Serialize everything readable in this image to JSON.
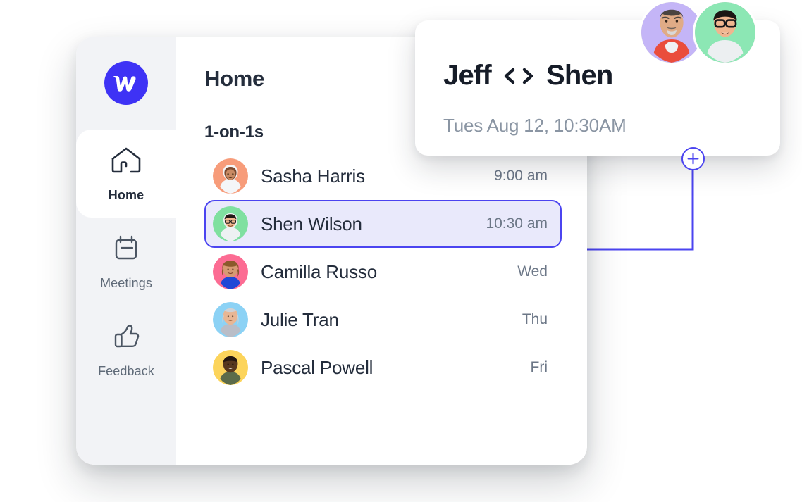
{
  "app": {
    "logo_icon": "webflow-logo-icon",
    "brand_color": "#3E32F5"
  },
  "sidebar": {
    "items": [
      {
        "label": "Home",
        "icon": "home-icon",
        "active": true
      },
      {
        "label": "Meetings",
        "icon": "calendar-icon",
        "active": false
      },
      {
        "label": "Feedback",
        "icon": "thumbs-up-icon",
        "active": false
      }
    ]
  },
  "main": {
    "page_title": "Home",
    "section_title": "1-on-1s",
    "rows": [
      {
        "name": "Sasha Harris",
        "time": "9:00 am",
        "avatar_bg": "#F79C7A",
        "selected": false
      },
      {
        "name": "Shen Wilson",
        "time": "10:30 am",
        "avatar_bg": "#7FE0A0",
        "selected": true
      },
      {
        "name": "Camilla Russo",
        "time": "Wed",
        "avatar_bg": "#FC6C93",
        "selected": false
      },
      {
        "name": "Julie Tran",
        "time": "Thu",
        "avatar_bg": "#8CD2F5",
        "selected": false
      },
      {
        "name": "Pascal Powell",
        "time": "Fri",
        "avatar_bg": "#FCD45B",
        "selected": false
      }
    ],
    "selection_color": "#4b44f0",
    "selection_fill": "#e9e9fb"
  },
  "meeting_card": {
    "title_left": "Jeff",
    "title_separator": "<>",
    "title_right": "Shen",
    "subtitle": "Tues Aug 12, 10:30AM",
    "avatars": [
      {
        "name": "Jeff",
        "bg": "#C4B5F7"
      },
      {
        "name": "Shen",
        "bg": "#8CE7B4"
      }
    ]
  },
  "connector": {
    "add_button_icon": "plus-icon",
    "line_color": "#4b44f0"
  }
}
